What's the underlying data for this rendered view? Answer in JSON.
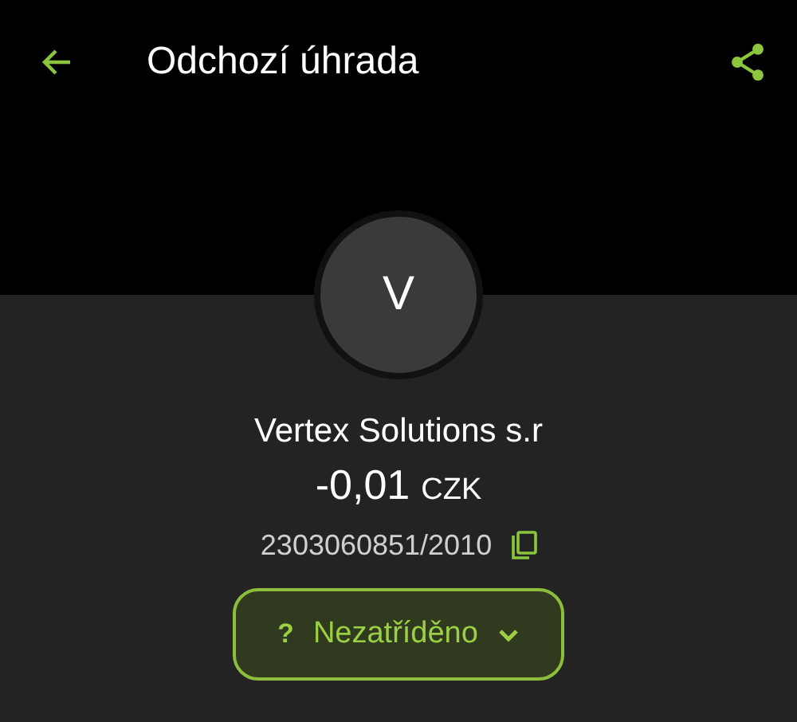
{
  "app_bar": {
    "title": "Odchozí úhrada"
  },
  "counterparty": {
    "avatar_letter": "V",
    "name": "Vertex Solutions s.r",
    "amount": "-0,01",
    "currency": "CZK",
    "account": "2303060851/2010"
  },
  "category": {
    "icon": "?",
    "label": "Nezatříděno"
  }
}
